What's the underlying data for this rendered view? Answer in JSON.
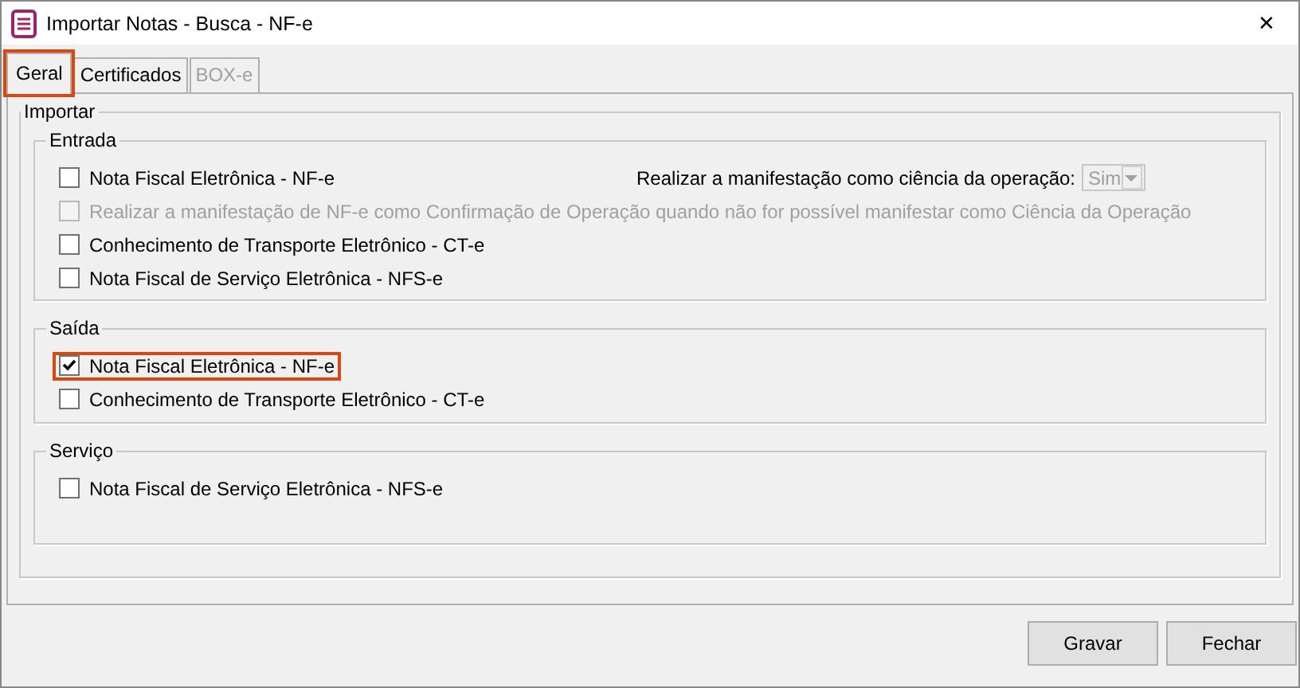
{
  "window": {
    "title": "Importar Notas - Busca - NF-e",
    "close": "✕"
  },
  "tabs": [
    {
      "label": "Geral",
      "selected": true,
      "disabled": false,
      "highlighted": true
    },
    {
      "label": "Certificados",
      "selected": false,
      "disabled": false,
      "highlighted": false
    },
    {
      "label": "BOX-e",
      "selected": false,
      "disabled": true,
      "highlighted": false
    }
  ],
  "import_group": {
    "title": "Importar",
    "groups": [
      {
        "title": "Entrada",
        "option": {
          "label": "Realizar a manifestação como ciência da operação:",
          "value": "Sim",
          "disabled": true
        },
        "items": [
          {
            "label": "Nota Fiscal Eletrônica - NF-e",
            "checked": false,
            "disabled": false,
            "highlighted": false
          },
          {
            "label": "Realizar a manifestação de NF-e como Confirmação de Operação quando não for possível manifestar como Ciência da Operação",
            "checked": false,
            "disabled": true,
            "highlighted": false
          },
          {
            "label": "Conhecimento de Transporte Eletrônico - CT-e",
            "checked": false,
            "disabled": false,
            "highlighted": false
          },
          {
            "label": "Nota Fiscal de Serviço Eletrônica - NFS-e",
            "checked": false,
            "disabled": false,
            "highlighted": false
          }
        ]
      },
      {
        "title": "Saída",
        "items": [
          {
            "label": "Nota Fiscal Eletrônica - NF-e",
            "checked": true,
            "disabled": false,
            "highlighted": true
          },
          {
            "label": "Conhecimento de Transporte Eletrônico - CT-e",
            "checked": false,
            "disabled": false,
            "highlighted": false
          }
        ]
      },
      {
        "title": "Serviço",
        "items": [
          {
            "label": "Nota Fiscal de Serviço Eletrônica - NFS-e",
            "checked": false,
            "disabled": false,
            "highlighted": false
          }
        ]
      }
    ]
  },
  "buttons": [
    "Gravar",
    "Fechar"
  ]
}
